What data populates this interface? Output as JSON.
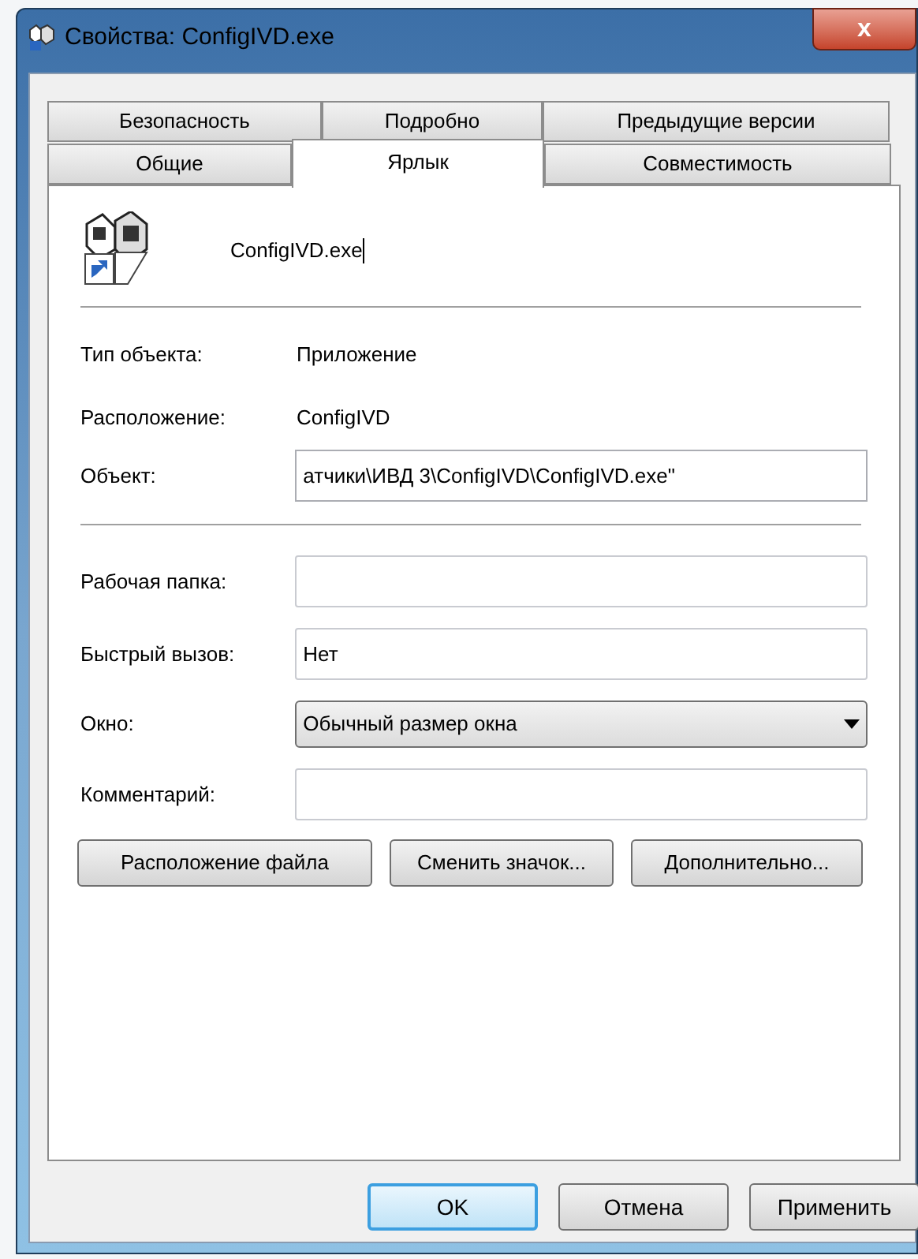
{
  "window": {
    "title": "Свойства: ConfigIVD.exe",
    "close_label": "x"
  },
  "tabs": [
    [
      {
        "label": "Безопасность",
        "selected": false
      },
      {
        "label": "Подробно",
        "selected": false
      },
      {
        "label": "Предыдущие версии",
        "selected": false
      }
    ],
    [
      {
        "label": "Общие",
        "selected": false
      },
      {
        "label": "Ярлык",
        "selected": true
      },
      {
        "label": "Совместимость",
        "selected": false
      }
    ]
  ],
  "file_name": "ConfigIVD.exe",
  "info": [
    {
      "label": "Тип объекта:",
      "value": "Приложение"
    },
    {
      "label": "Расположение:",
      "value": "ConfigIVD"
    }
  ],
  "target": {
    "label": "Объект:",
    "value": "атчики\\ИВД 3\\ConfigIVD\\ConfigIVD.exe\""
  },
  "fields": [
    {
      "kind": "text",
      "label": "Рабочая папка:"
    },
    {
      "kind": "text",
      "label": "Быстрый вызов:",
      "value": "Нет"
    },
    {
      "kind": "select",
      "label": "Окно:",
      "value": "Обычный размер окна"
    },
    {
      "kind": "text",
      "label": "Комментарий:"
    }
  ],
  "buttons": [
    "Расположение файла",
    "Сменить значок...",
    "Дополнительно..."
  ],
  "dialog_buttons": [
    {
      "label": "OK",
      "default": true
    },
    {
      "label": "Отмена",
      "default": false
    },
    {
      "label": "Применить",
      "default": false
    }
  ]
}
